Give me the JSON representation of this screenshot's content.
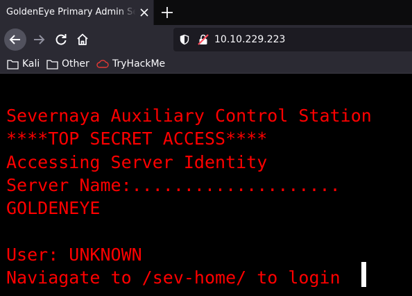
{
  "browser": {
    "tab_title": "GoldenEye Primary Admin Server",
    "url": "10.10.229.223",
    "bookmarks": [
      "Kali",
      "Other",
      "TryHackMe"
    ]
  },
  "terminal": {
    "lines": [
      "Severnaya Auxiliary Control Station",
      "****TOP SECRET ACCESS****",
      "Accessing Server Identity",
      "Server Name:....................",
      "GOLDENEYE",
      "",
      "User: UNKNOWN",
      "Naviagate to /sev-home/ to login"
    ],
    "text_color": "#ff0000",
    "background": "#000000"
  }
}
